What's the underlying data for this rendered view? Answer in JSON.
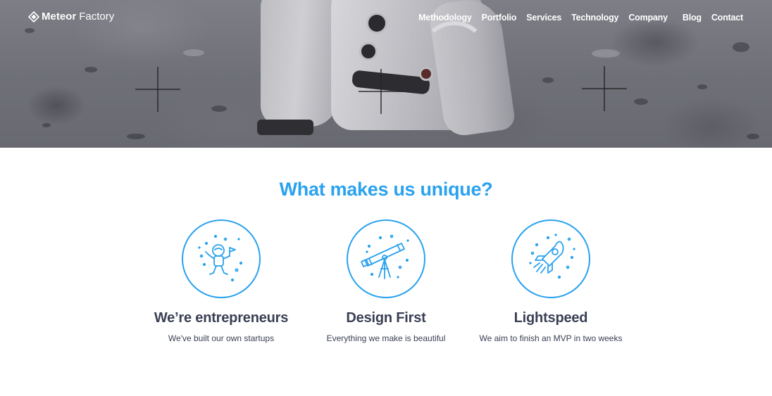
{
  "header": {
    "logo": {
      "bold": "Meteor",
      "light": "Factory",
      "icon": "diamond-logo-icon"
    },
    "nav": [
      {
        "label": "Methodology"
      },
      {
        "label": "Portfolio"
      },
      {
        "label": "Services"
      },
      {
        "label": "Technology"
      },
      {
        "label": "Company"
      },
      {
        "label": "Blog"
      },
      {
        "label": "Contact"
      }
    ]
  },
  "main": {
    "title": "What makes us unique?",
    "features": [
      {
        "icon": "astronaut-icon",
        "title": "We’re entrepreneurs",
        "description": "We've built our own startups"
      },
      {
        "icon": "telescope-icon",
        "title": "Design First",
        "description": "Everything we make is beautiful"
      },
      {
        "icon": "rocket-icon",
        "title": "Lightspeed",
        "description": "We aim to finish an MVP in two weeks"
      }
    ]
  },
  "colors": {
    "accent": "#2aa2ee",
    "heading": "#3a3f54",
    "nav_text": "#ffffff"
  }
}
